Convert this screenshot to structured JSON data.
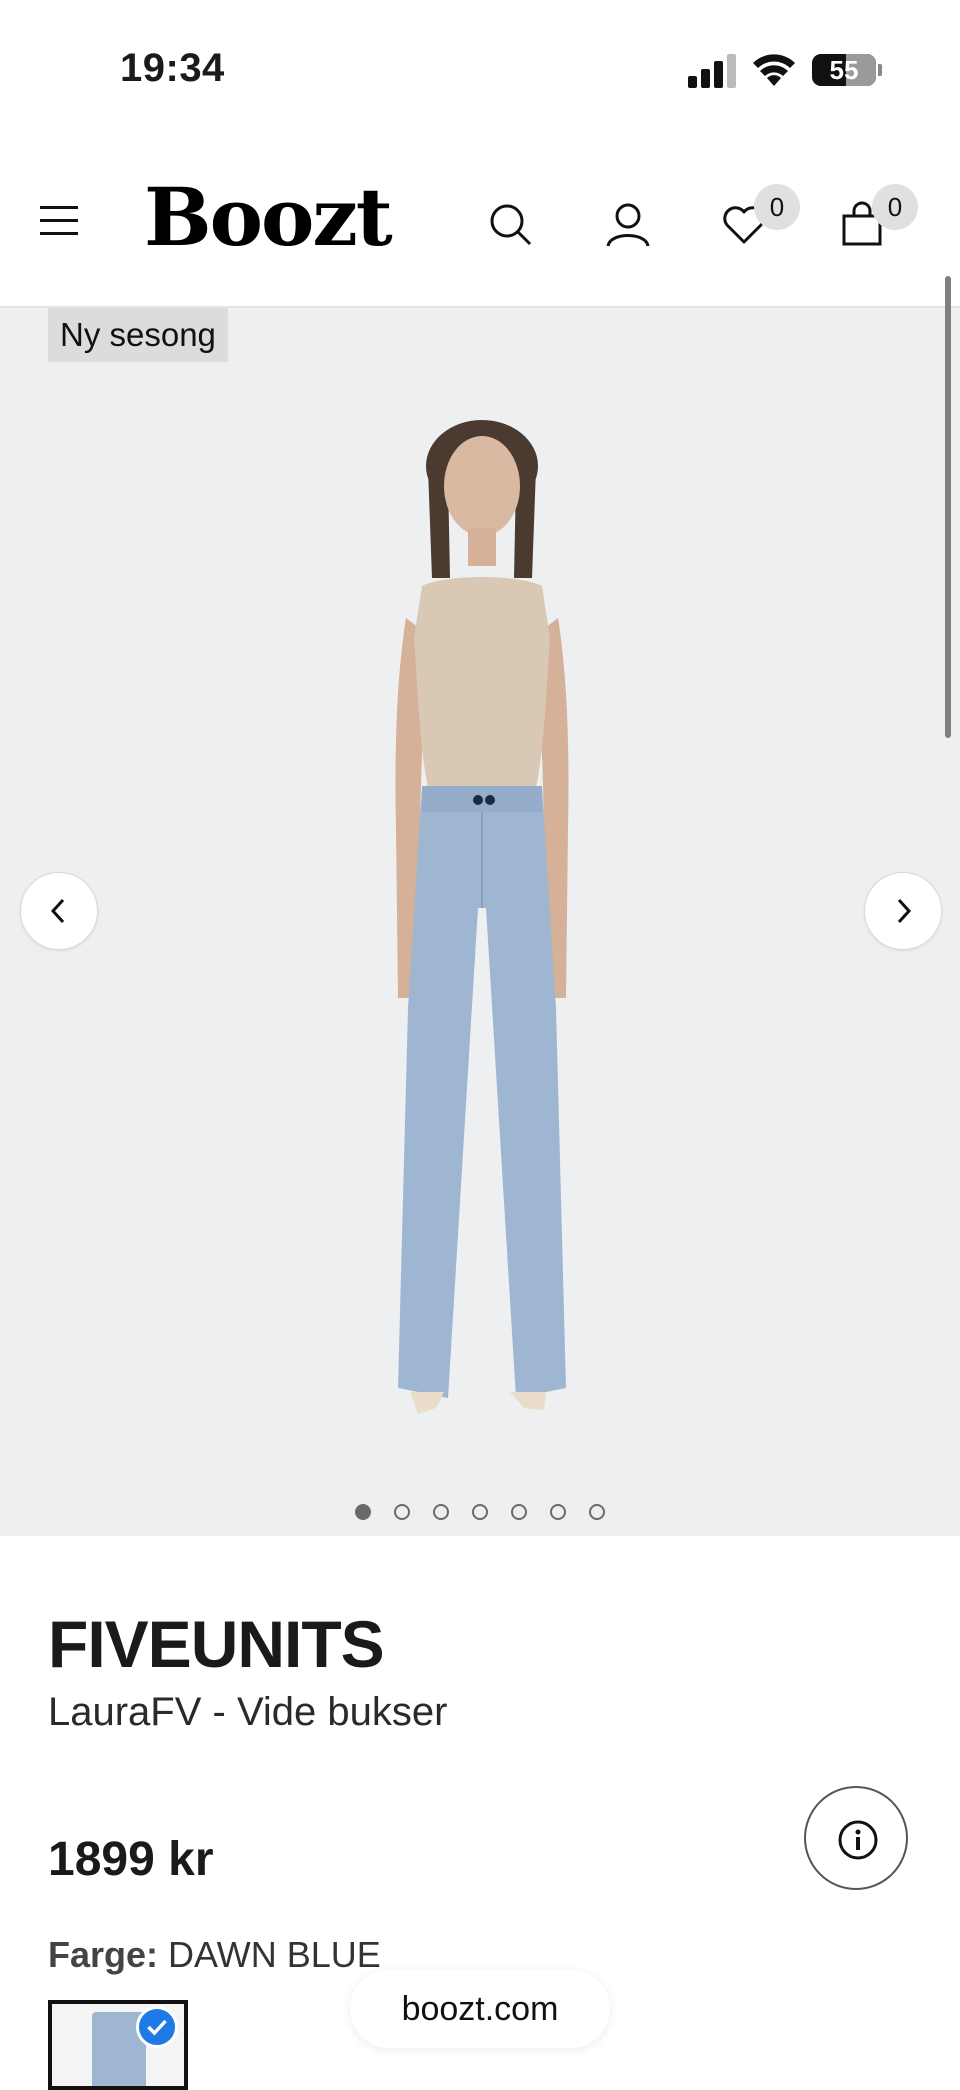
{
  "status_bar": {
    "time": "19:34",
    "battery": "55"
  },
  "header": {
    "logo": "Boozt",
    "wishlist_count": "0",
    "cart_count": "0",
    "icons": [
      "menu-icon",
      "search-icon",
      "user-icon",
      "heart-icon",
      "bag-icon"
    ]
  },
  "gallery": {
    "tag": "Ny sesong",
    "image_count": 7,
    "active_index": 0,
    "icons": [
      "chevron-left-icon",
      "chevron-right-icon"
    ]
  },
  "product": {
    "brand": "FIVEUNITS",
    "name": "LauraFV - Vide bukser",
    "price": "1899 kr",
    "color_label": "Farge:",
    "color_value": "DAWN BLUE"
  },
  "browser": {
    "url": "boozt.com"
  },
  "colors": {
    "accent": "#1f7ae8",
    "pants": "#9fb6d3",
    "top": "#d8c8b4",
    "background": "#eeeff1"
  }
}
